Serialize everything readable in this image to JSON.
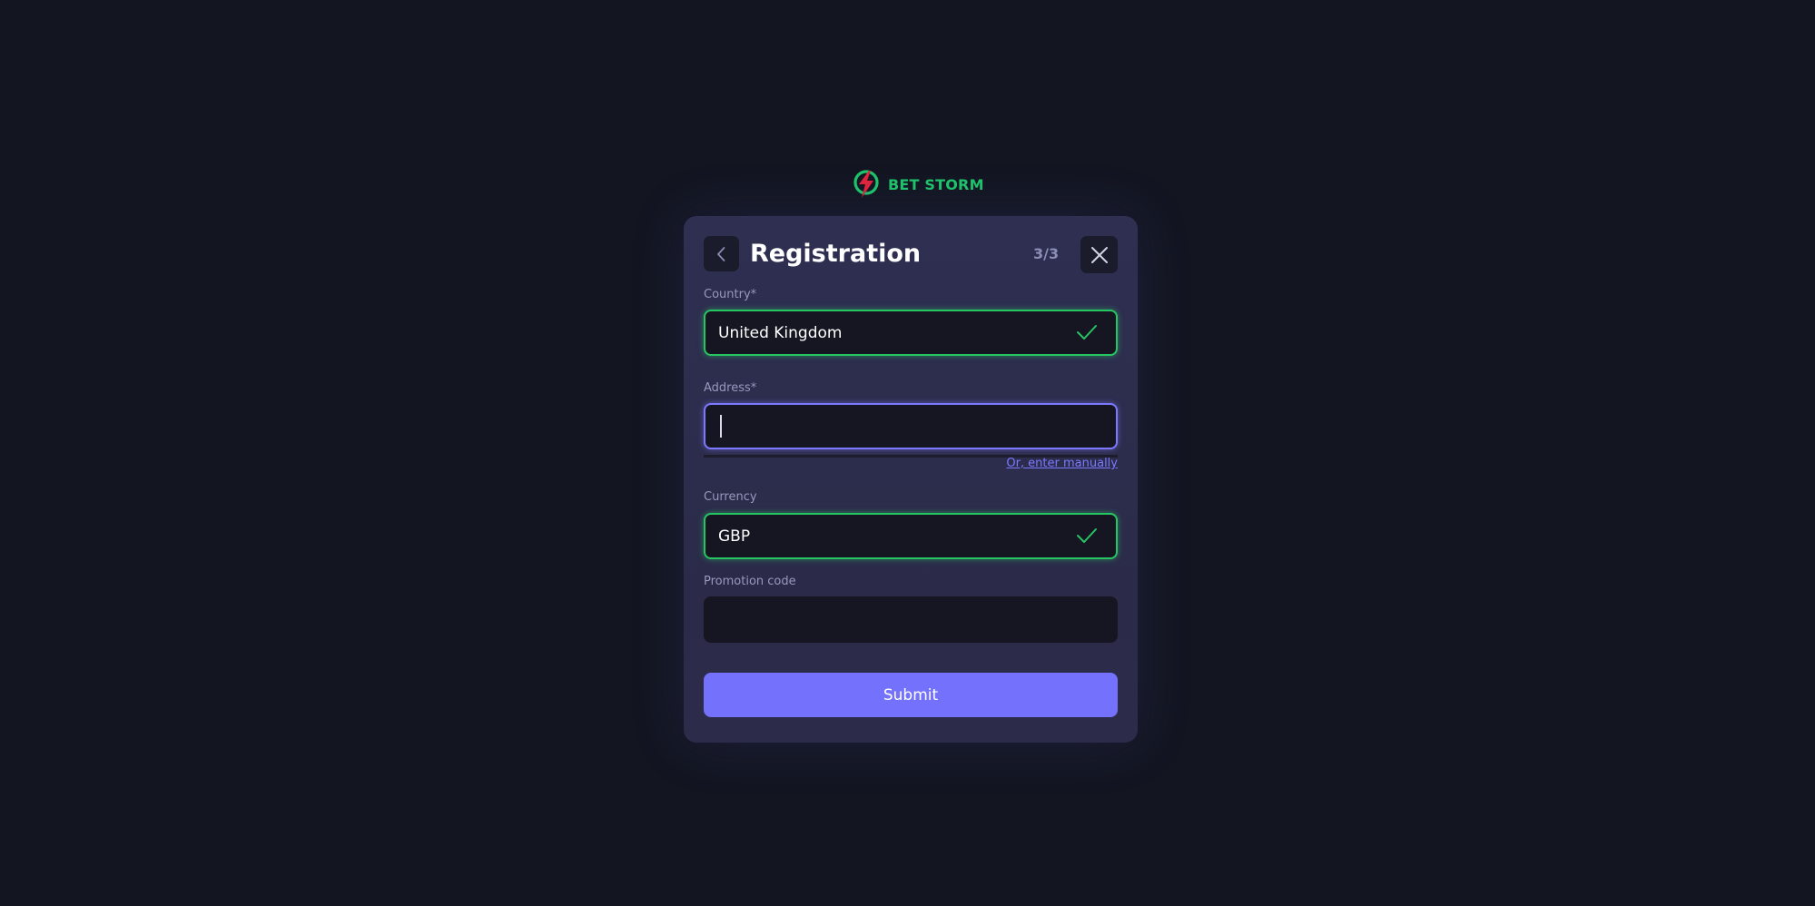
{
  "brand": {
    "name": "BET STORM",
    "logo_icon": "lightning-bolt-icon",
    "color": "#1fc46b",
    "accent": "#e0243a"
  },
  "modal": {
    "title": "Registration",
    "step": "3/3",
    "back_icon": "chevron-left-icon",
    "close_icon": "close-icon"
  },
  "form": {
    "country": {
      "label": "Country*",
      "value": "United Kingdom",
      "status": "valid"
    },
    "address": {
      "label": "Address*",
      "value": "",
      "status": "focused",
      "manual_link": "Or, enter manually"
    },
    "currency": {
      "label": "Currency",
      "value": "GBP",
      "status": "valid"
    },
    "promotion_code": {
      "label": "Promotion code",
      "value": ""
    },
    "submit_label": "Submit"
  },
  "colors": {
    "background": "#131621",
    "panel": "#2e2e4f",
    "valid": "#27c561",
    "focus": "#7c79ff",
    "primary_button": "#7471fd"
  }
}
